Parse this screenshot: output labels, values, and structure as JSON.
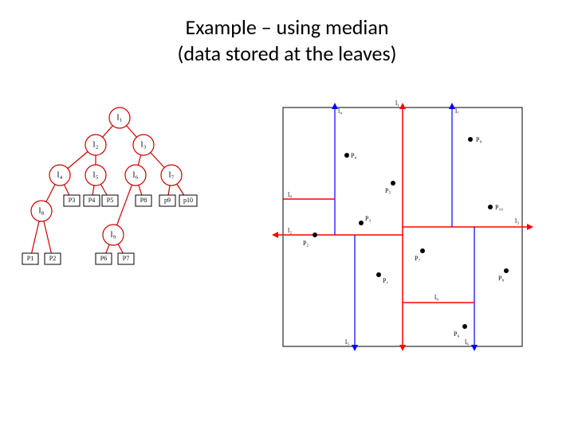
{
  "title": {
    "line1": "Example – using median",
    "line2": "(data stored at the leaves)"
  },
  "tree": {
    "nodes": {
      "l1": "l₁",
      "l2": "l₂",
      "l3": "l₃",
      "l4": "l₄",
      "l5": "l₅",
      "l6": "l₆",
      "l7": "l₇",
      "l8": "l₈",
      "l9": "l₉"
    },
    "leaves": {
      "p1": "P1",
      "p2": "P2",
      "p3": "P3",
      "p4": "P4",
      "p5": "P5",
      "p6": "P6",
      "p7": "P7",
      "p8": "P8",
      "p9": "p9",
      "p10": "p10"
    }
  },
  "plane": {
    "lines": {
      "l1": "l₁",
      "l2": "l₂",
      "l3": "l₃",
      "l4": "l₄",
      "l5": "l₅",
      "l6": "l₆",
      "l7": "l₇",
      "l8": "l₈",
      "l9": "l₉"
    },
    "points": {
      "p1": "P₁",
      "p2": "P₂",
      "p3": "P₃",
      "p4": "P₄",
      "p5": "P₅",
      "p6": "P₆",
      "p7": "P₇",
      "p8": "P₈",
      "p9": "P₉",
      "p10": "P₁₀"
    }
  }
}
